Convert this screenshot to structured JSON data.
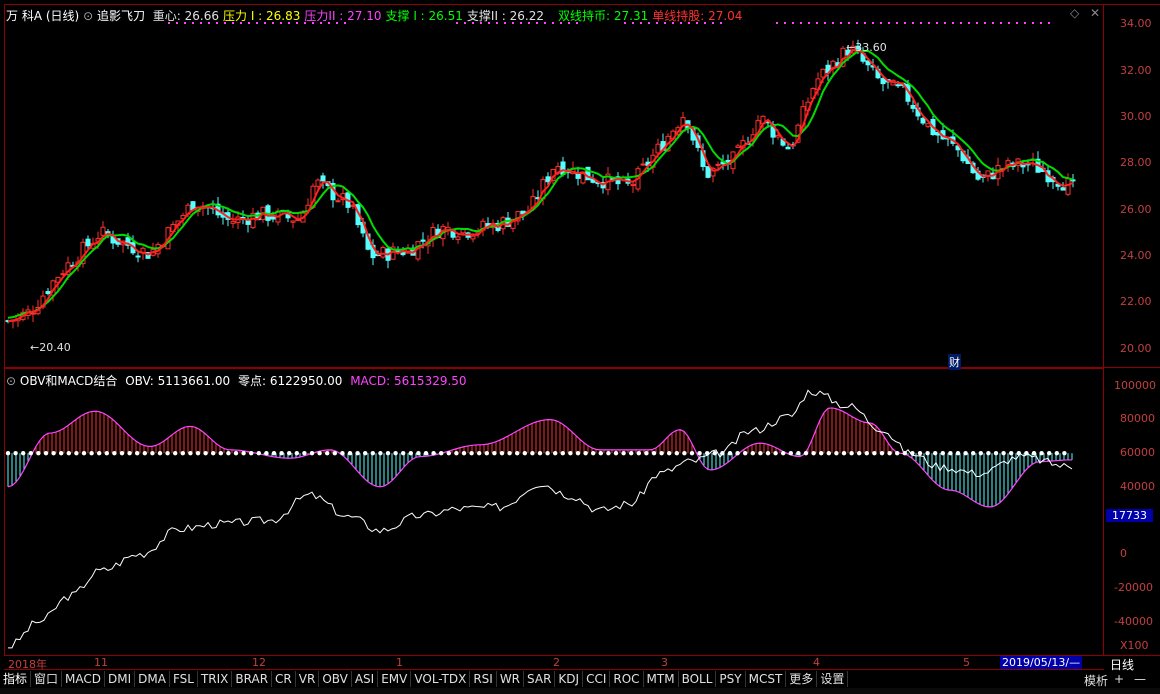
{
  "header": {
    "stock": "万 科A",
    "period": "(日线)",
    "indicator": "追影飞刀",
    "items": [
      {
        "label": "重心: 26.66",
        "color": "#e0e0e0"
      },
      {
        "label": "压力 I : 26.83",
        "color": "#ffff00"
      },
      {
        "label": "压力II : 27.10",
        "color": "#ff44ff"
      },
      {
        "label": "支撑 I : 26.51",
        "color": "#00ff00"
      },
      {
        "label": "支撑II : 26.22",
        "color": "#e0e0e0"
      },
      {
        "label": "双线持币: 27.31",
        "color": "#00ff00"
      },
      {
        "label": "单线持股: 27.04",
        "color": "#ff3030"
      }
    ]
  },
  "main_axis": [
    "34.00",
    "32.00",
    "30.00",
    "28.00",
    "26.00",
    "24.00",
    "22.00",
    "20.00"
  ],
  "annotations": {
    "high": "33.60",
    "low": "20.40",
    "badge": "财"
  },
  "sub_header": {
    "name": "OBV和MACD结合",
    "obv": "OBV: 5113661.00",
    "zero": "零点: 6122950.00",
    "macd": "MACD: 5615329.50"
  },
  "sub_axis": [
    "100000",
    "80000",
    "60000",
    "40000",
    "17733",
    "0",
    "-20000",
    "-40000",
    "X100"
  ],
  "time_axis": [
    "2018年",
    "11",
    "12",
    "1",
    "2",
    "3",
    "4",
    "5",
    "2019/05/13/—"
  ],
  "tabs": [
    "指标",
    "窗口",
    "MACD",
    "DMI",
    "DMA",
    "FSL",
    "TRIX",
    "BRAR",
    "CR",
    "VR",
    "OBV",
    "ASI",
    "EMV",
    "VOL-TDX",
    "RSI",
    "WR",
    "SAR",
    "KDJ",
    "CCI",
    "ROC",
    "MTM",
    "BOLL",
    "PSY",
    "MCST",
    "更多",
    "设置"
  ],
  "right_buttons": {
    "mode": "模析",
    "plus": "+",
    "minus": "—",
    "period": "日线"
  },
  "colors": {
    "up": "#ff3030",
    "down": "#54ffff",
    "red_line": "#ff2020",
    "green_line": "#00dd00",
    "obv": "#ffffff",
    "macd": "#ff44ff"
  }
}
